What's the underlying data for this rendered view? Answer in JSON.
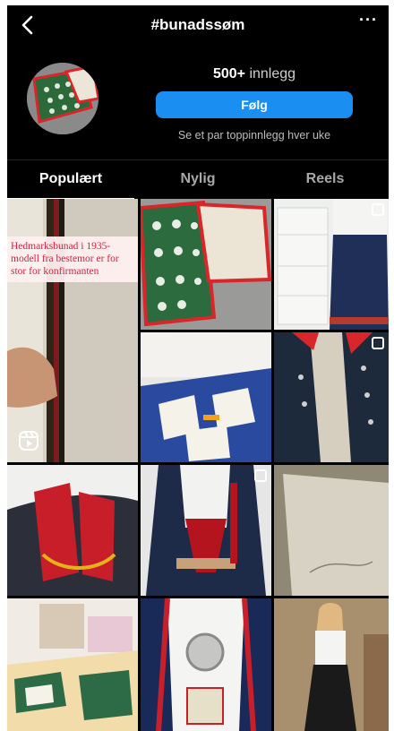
{
  "header": {
    "title": "#bunadssøm",
    "more_label": "···"
  },
  "profile": {
    "post_count": "500+",
    "post_unit": "innlegg",
    "follow_label": "Følg",
    "subtext": "Se et par toppinnlegg hver uke"
  },
  "tabs": [
    {
      "label": "Populært",
      "active": true
    },
    {
      "label": "Nylig",
      "active": false
    },
    {
      "label": "Reels",
      "active": false
    }
  ],
  "posts": {
    "featured_caption": "Hedmarksbunad i 1935-modell fra bestemor er for stor for konfirmanten"
  },
  "icons": {
    "back": "chevron-left-icon",
    "more": "more-dots-icon",
    "multi_post": "multiple-posts-icon",
    "reels": "reels-icon"
  },
  "colors": {
    "background": "#000000",
    "follow_button": "#1b8ef2",
    "muted_text": "#a8a8a8",
    "caption_text": "#d4213f"
  }
}
